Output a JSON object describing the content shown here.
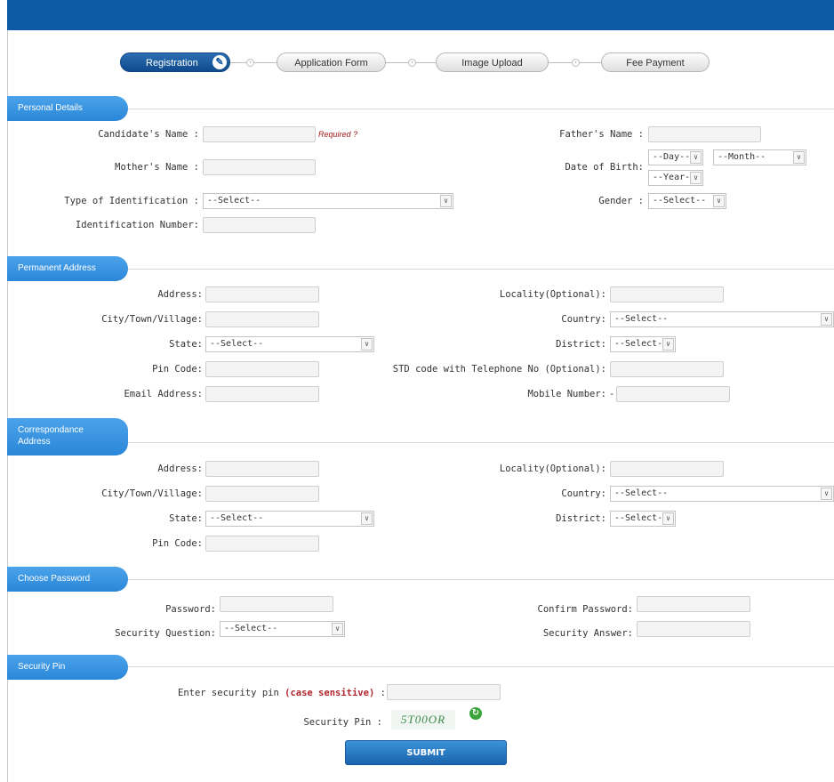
{
  "steps": [
    "Registration",
    "Application Form",
    "Image Upload",
    "Fee Payment"
  ],
  "icons": {
    "edit": "pencil-icon",
    "step_arrow": "chevron-circle-icon",
    "dropdown": "chevron-down-icon",
    "refresh": "refresh-icon"
  },
  "colors": {
    "topbar": "#0a5aa6",
    "section": "#2a86d8",
    "required": "#a11a1a",
    "captcha": "#3a8a4a"
  },
  "personal": {
    "header": "Personal Details",
    "candidate_name_label": "Candidate's Name :",
    "required_text": "Required ?",
    "father_name_label": "Father's Name :",
    "mother_name_label": "Mother's Name :",
    "dob_label": "Date of Birth:",
    "dob_day": "--Day--",
    "dob_month": "--Month--",
    "dob_year": "--Year--",
    "id_type_label": "Type of Identification :",
    "id_type_value": "--Select--",
    "gender_label": "Gender :",
    "gender_value": "--Select--",
    "id_number_label": "Identification Number:"
  },
  "permanent": {
    "header": "Permanent Address",
    "address_label": "Address:",
    "locality_label": "Locality(Optional):",
    "city_label": "City/Town/Village:",
    "country_label": "Country:",
    "country_value": "--Select--",
    "state_label": "State:",
    "state_value": "--Select--",
    "district_label": "District:",
    "district_value": "--Select--",
    "pin_label": "Pin Code:",
    "std_label": "STD code with Telephone No (Optional):",
    "email_label": "Email Address:",
    "mobile_label": "Mobile Number:",
    "mobile_prefix": "-"
  },
  "correspondence": {
    "header_line1": "Correspondance",
    "header_line2": "Address",
    "address_label": "Address:",
    "locality_label": "Locality(Optional):",
    "city_label": "City/Town/Village:",
    "country_label": "Country:",
    "country_value": "--Select--",
    "state_label": "State:",
    "state_value": "--Select--",
    "district_label": "District:",
    "district_value": "--Select--",
    "pin_label": "Pin Code:"
  },
  "password": {
    "header": "Choose Password",
    "password_label": "Password:",
    "confirm_label": "Confirm Password:",
    "question_label": "Security Question:",
    "question_value": "--Select--",
    "answer_label": "Security Answer:"
  },
  "security": {
    "header": "Security Pin",
    "enter_label": "Enter security pin",
    "case_sensitive": "(case sensitive)",
    "enter_colon": ":",
    "pin_label": "Security Pin :",
    "captcha_text": "5T00OR",
    "submit_label": "SUBMIT"
  }
}
